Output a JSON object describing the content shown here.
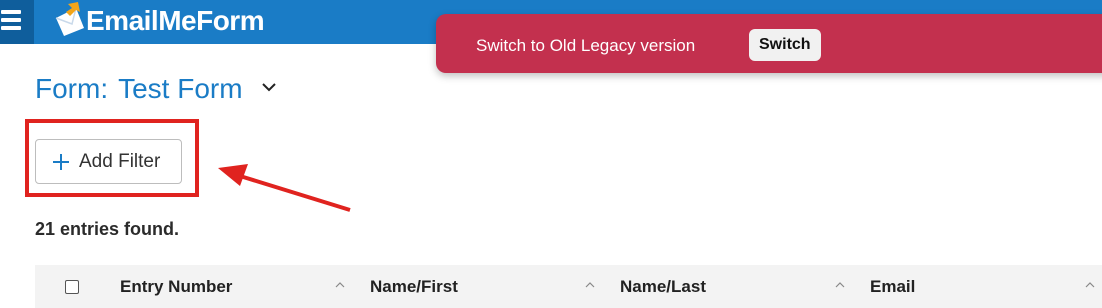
{
  "app": {
    "logo_text": "EmailMeForm"
  },
  "banner": {
    "message": "Switch to Old Legacy version",
    "button_label": "Switch"
  },
  "form": {
    "prefix": "Form:",
    "name": "Test Form"
  },
  "filter": {
    "add_label": "Add Filter"
  },
  "results": {
    "count_text": "21 entries found."
  },
  "table": {
    "columns": [
      {
        "label": "Entry Number"
      },
      {
        "label": "Name/First"
      },
      {
        "label": "Name/Last"
      },
      {
        "label": "Email"
      }
    ]
  },
  "colors": {
    "topbar": "#1a7cc6",
    "banner": "#c3304e",
    "highlight": "#e0231f",
    "title": "#1a7cc6"
  },
  "icons": [
    "menu-icon",
    "envelope-logo-icon",
    "chevron-down-icon",
    "plus-icon",
    "annotation-arrow",
    "sort-icon"
  ]
}
